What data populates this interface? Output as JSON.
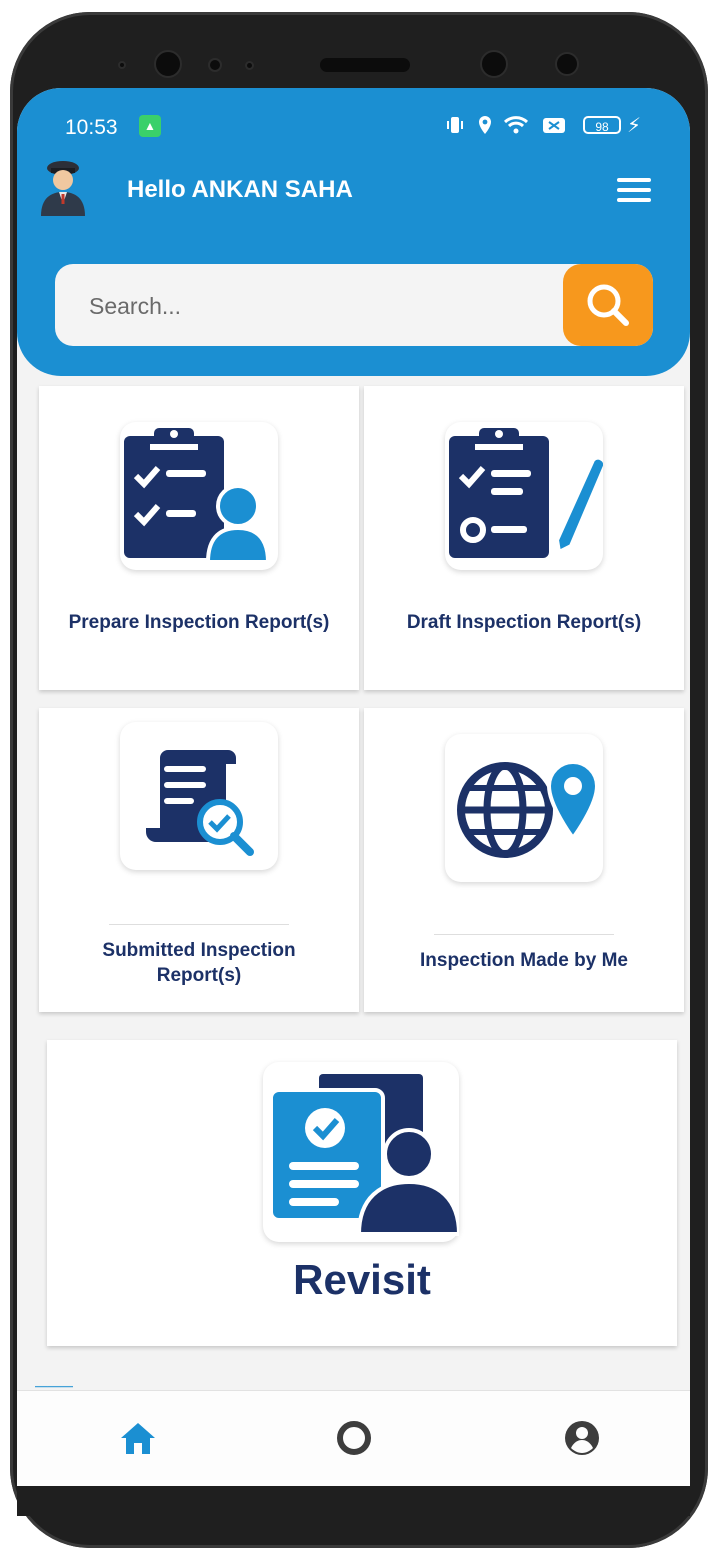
{
  "status_bar": {
    "time": "10:53",
    "battery": "98"
  },
  "header": {
    "greeting": "Hello  ANKAN SAHA"
  },
  "search": {
    "placeholder": "Search..."
  },
  "cards": [
    {
      "label": "Prepare Inspection Report(s)",
      "icon": "clipboard-user-icon"
    },
    {
      "label": "Draft Inspection Report(s)",
      "icon": "clipboard-pen-icon"
    },
    {
      "label": "Submitted Inspection Report(s)",
      "icon": "document-search-icon"
    },
    {
      "label": "Inspection Made by Me",
      "icon": "globe-pin-icon"
    }
  ],
  "revisit": {
    "label": "Revisit",
    "icon": "revisit-person-icon"
  },
  "bottom_nav": {
    "items": [
      "home-icon",
      "circle-icon",
      "account-icon"
    ],
    "active": "home-icon"
  },
  "colors": {
    "header": "#1b8fd2",
    "search_button": "#f7981d",
    "label_text": "#1c3167",
    "icon_navy": "#1c3167",
    "icon_blue": "#1b8fd2",
    "active_nav": "#1b8fd2",
    "inactive_nav": "#3d3d3d"
  }
}
